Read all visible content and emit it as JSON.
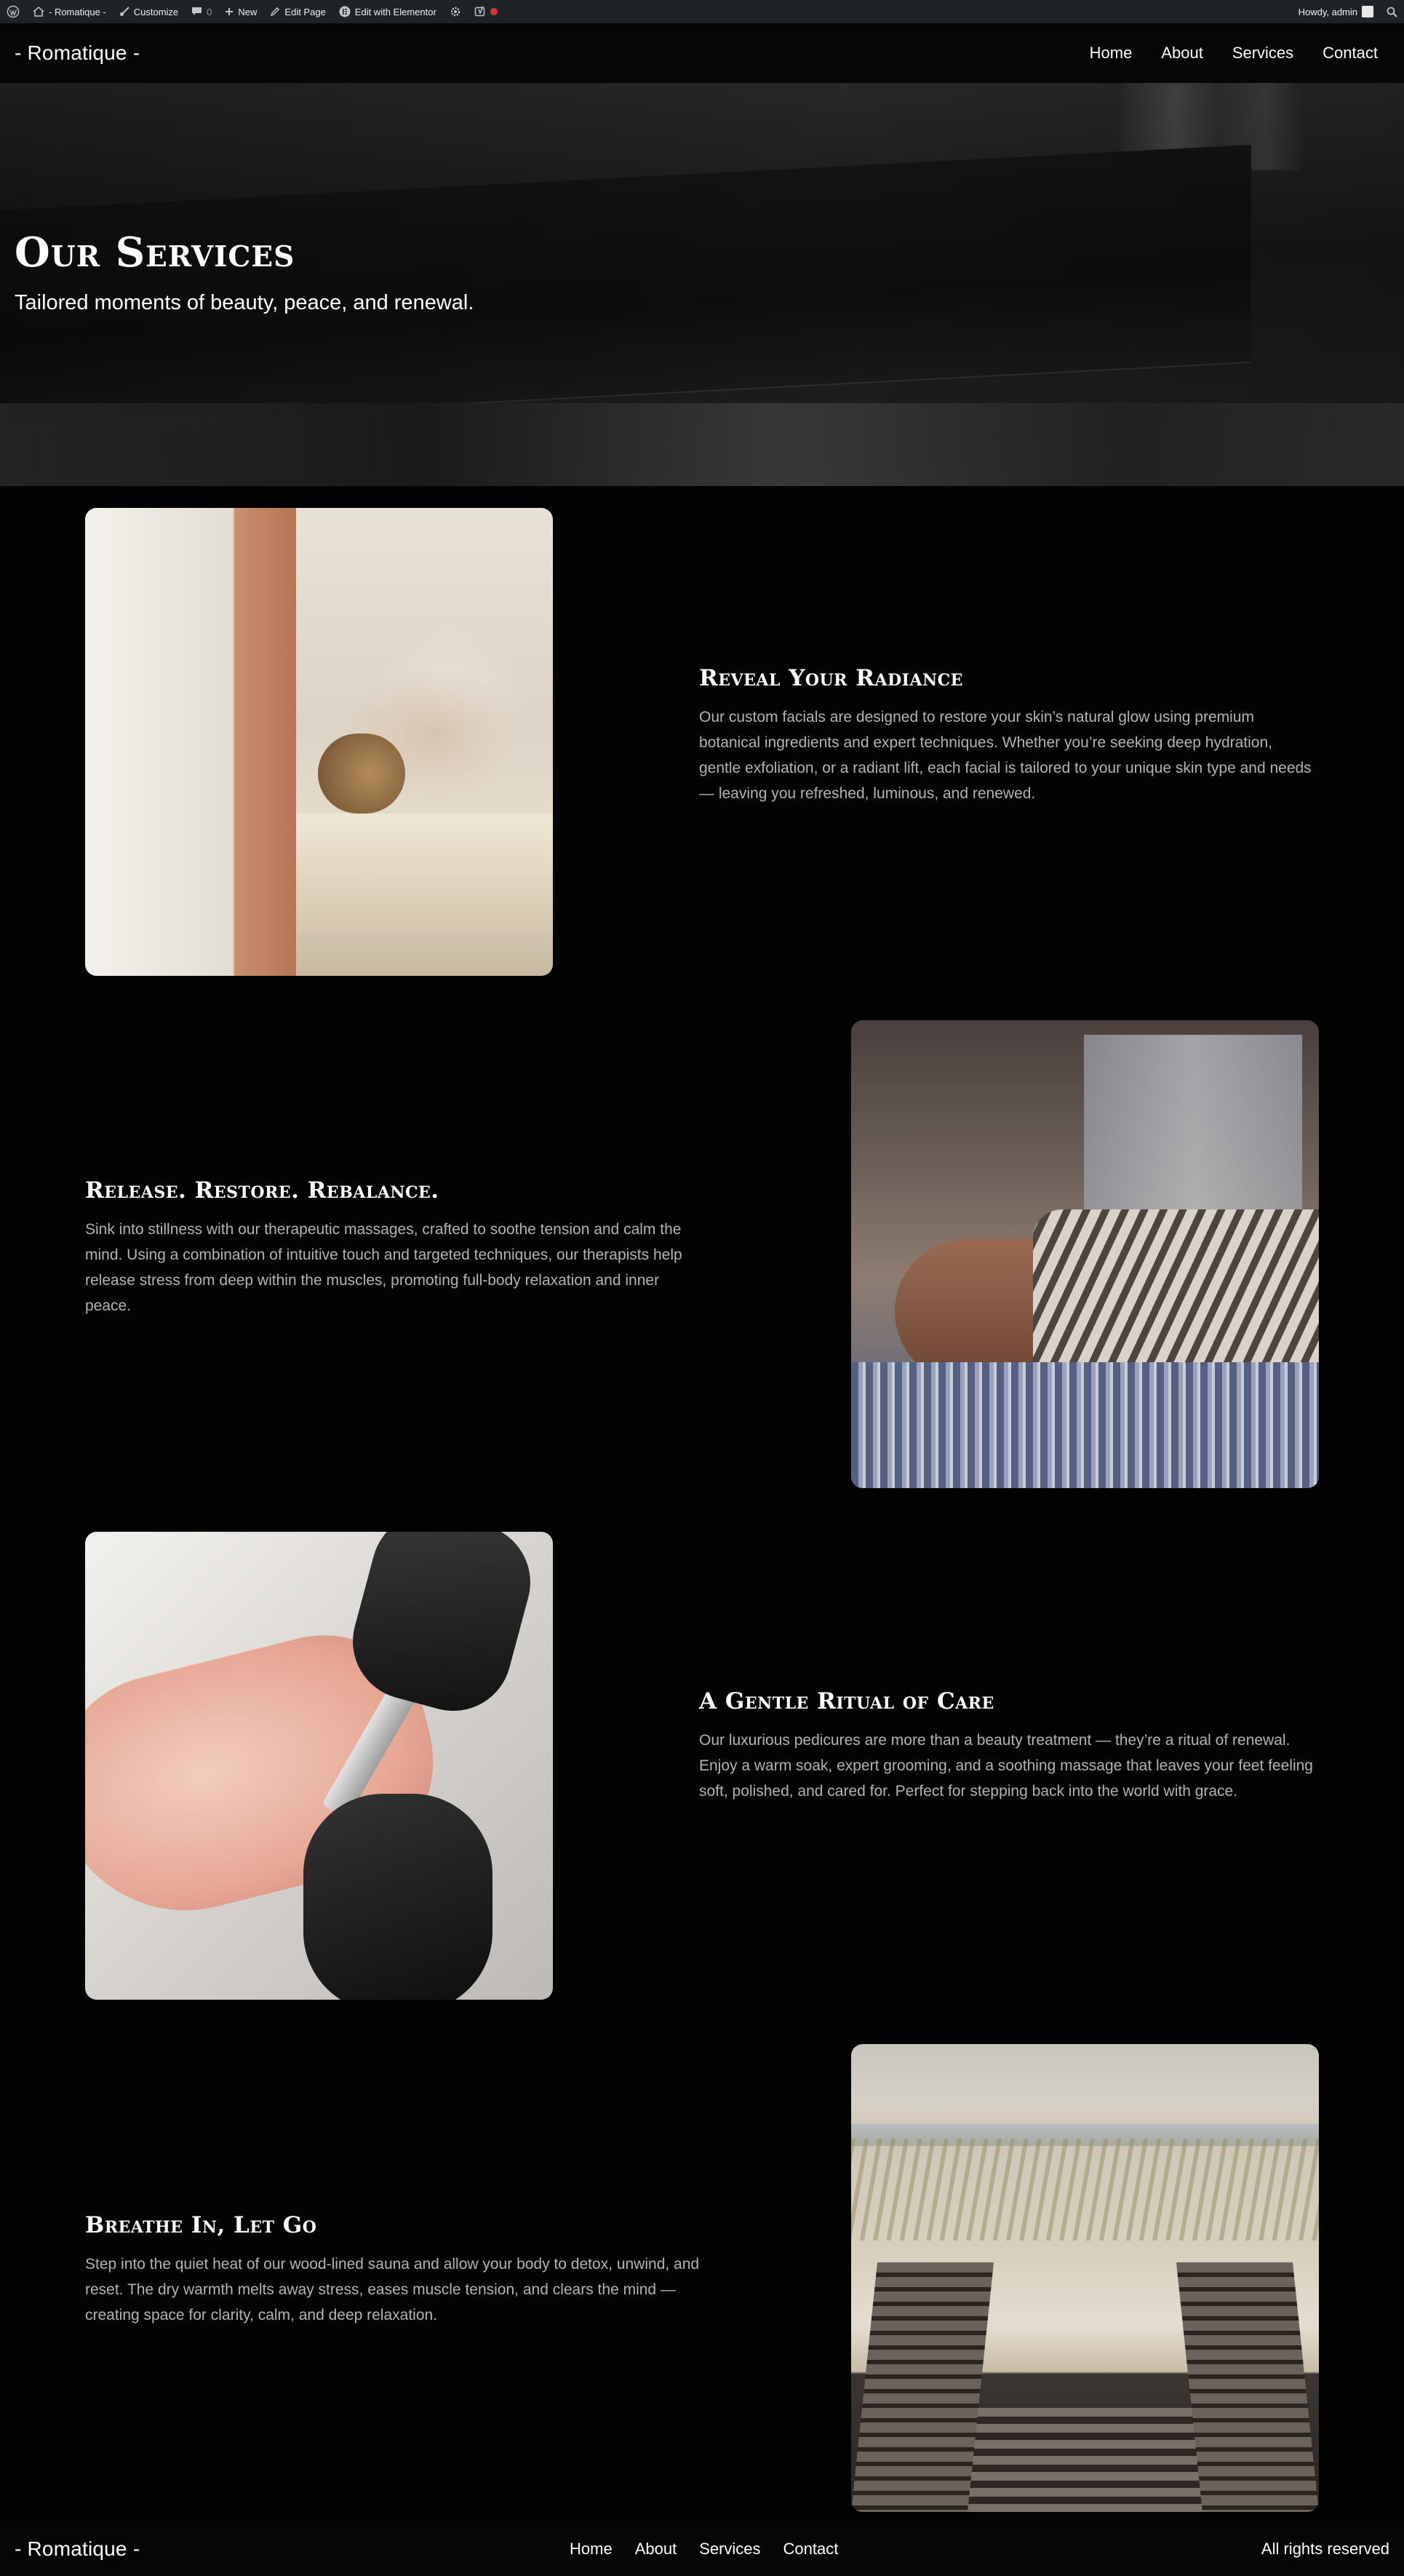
{
  "admin_bar": {
    "site_name": "- Romatique -",
    "customize": "Customize",
    "comments_count": "0",
    "new": "New",
    "edit_page": "Edit Page",
    "edit_elementor": "Edit with Elementor",
    "howdy": "Howdy, admin"
  },
  "header": {
    "site_title": "- Romatique -",
    "nav": [
      "Home",
      "About",
      "Services",
      "Contact"
    ]
  },
  "hero": {
    "title": "Our Services",
    "subtitle": "Tailored moments of beauty, peace, and renewal."
  },
  "services": [
    {
      "title": "Reveal Your Radiance",
      "description": "Our custom facials are designed to restore your skin’s natural glow using premium botanical ingredients and expert techniques. Whether you’re seeking deep hydration, gentle exfoliation, or a radiant lift, each facial is tailored to your unique skin type and needs — leaving you refreshed, luminous, and renewed."
    },
    {
      "title": "Release. Restore. Rebalance.",
      "description": "Sink into stillness with our therapeutic massages, crafted to soothe tension and calm the mind. Using a combination of intuitive touch and targeted techniques, our therapists help release stress from deep within the muscles, promoting full-body relaxation and inner peace."
    },
    {
      "title": "A Gentle Ritual of Care",
      "description": "Our luxurious pedicures are more than a beauty treatment — they’re a ritual of renewal. Enjoy a warm soak, expert grooming, and a soothing massage that leaves your feet feeling soft, polished, and cared for. Perfect for stepping back into the world with grace."
    },
    {
      "title": "Breathe In, Let Go",
      "description": "Step into the quiet heat of our wood-lined sauna and allow your body to detox, unwind, and reset. The dry warmth melts away stress, eases muscle tension, and clears the mind — creating space for clarity, calm, and deep relaxation."
    }
  ],
  "footer": {
    "site_title": "- Romatique -",
    "nav": [
      "Home",
      "About",
      "Services",
      "Contact"
    ],
    "copyright": "All rights reserved"
  },
  "colors": {
    "background": "#030303",
    "admin_bar": "#1d2327",
    "body_text": "#b3b3b3"
  }
}
